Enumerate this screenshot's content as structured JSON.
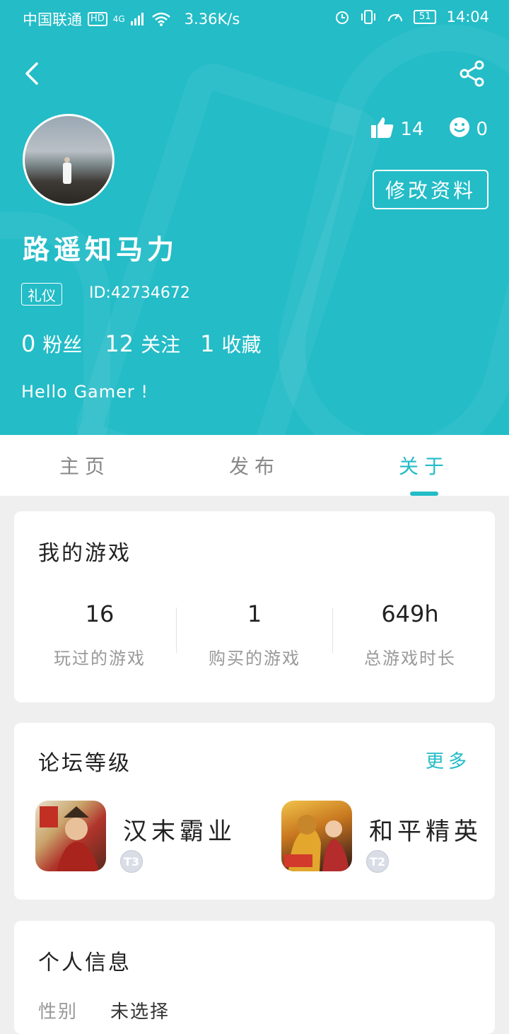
{
  "statusbar": {
    "carrier": "中国联通",
    "hd": "HD",
    "network": "4G",
    "speed": "3.36K/s",
    "battery": "51",
    "time": "14:04"
  },
  "profile": {
    "username": "路遥知马力",
    "tag": "礼仪",
    "id": "ID:42734672",
    "likes": "14",
    "smiles": "0",
    "edit_label": "修改资料",
    "fans_count": "0",
    "fans_label": "粉丝",
    "follow_count": "12",
    "follow_label": "关注",
    "fav_count": "1",
    "fav_label": "收藏",
    "bio": "Hello Gamer !"
  },
  "tabs": [
    {
      "label": "主页"
    },
    {
      "label": "发布"
    },
    {
      "label": "关于"
    }
  ],
  "my_games": {
    "title": "我的游戏",
    "stats": [
      {
        "value": "16",
        "label": "玩过的游戏"
      },
      {
        "value": "1",
        "label": "购买的游戏"
      },
      {
        "value": "649h",
        "label": "总游戏时长"
      }
    ]
  },
  "forum": {
    "title": "论坛等级",
    "more": "更多",
    "games": [
      {
        "name": "汉末霸业",
        "level": "T3"
      },
      {
        "name": "和平精英",
        "level": "T2"
      }
    ]
  },
  "personal": {
    "title": "个人信息",
    "gender_label": "性别",
    "gender_value": "未选择"
  },
  "colors": {
    "accent": "#23bcc7"
  }
}
